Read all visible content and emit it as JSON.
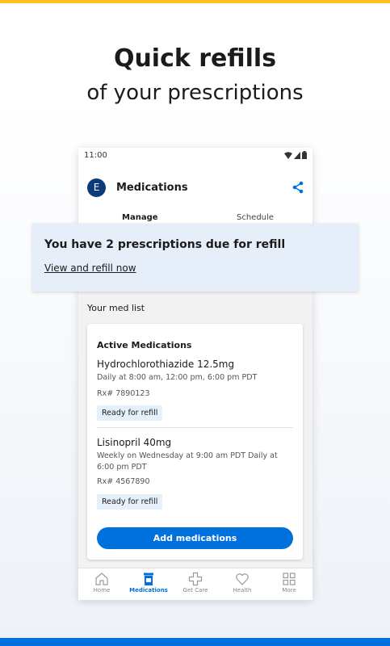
{
  "promo": {
    "headline": "Quick refills",
    "subline": "of your prescriptions"
  },
  "status_bar": {
    "time": "11:00",
    "icons": [
      "wifi-icon",
      "signal-icon",
      "battery-icon"
    ]
  },
  "app_bar": {
    "avatar_letter": "E",
    "title": "Medications",
    "share_icon": "share-icon"
  },
  "tabs": [
    {
      "label": "Manage",
      "selected": true
    },
    {
      "label": "Schedule",
      "selected": false
    }
  ],
  "refill_banner": {
    "title": "You have 2 prescriptions due for refill",
    "link": "View and refill now"
  },
  "med_list": {
    "label": "Your med list",
    "card_title": "Active Medications",
    "items": [
      {
        "name": "Hydrochlorothiazide 12.5mg",
        "schedule": "Daily at 8:00 am, 12:00 pm, 6:00 pm PDT",
        "rx": "Rx# 7890123",
        "status": "Ready for refill"
      },
      {
        "name": "Lisinopril 40mg",
        "schedule": "Weekly on Wednesday at 9:00 am PDT Daily at 6:00 pm PDT",
        "rx": "Rx# 4567890",
        "status": "Ready for refill"
      }
    ],
    "add_button": "Add medications"
  },
  "bottom_nav": [
    {
      "label": "Home",
      "icon": "home-icon",
      "active": false
    },
    {
      "label": "Medications",
      "icon": "pill-bottle-icon",
      "active": true
    },
    {
      "label": "Get Care",
      "icon": "medical-cross-icon",
      "active": false
    },
    {
      "label": "Health",
      "icon": "heart-icon",
      "active": false
    },
    {
      "label": "More",
      "icon": "grid-icon",
      "active": false
    }
  ],
  "colors": {
    "accent": "#0071dc",
    "top_bar": "#ffc220",
    "avatar": "#0d3a78",
    "banner_bg": "#e6eef9",
    "badge_bg": "#e6f0fa"
  }
}
